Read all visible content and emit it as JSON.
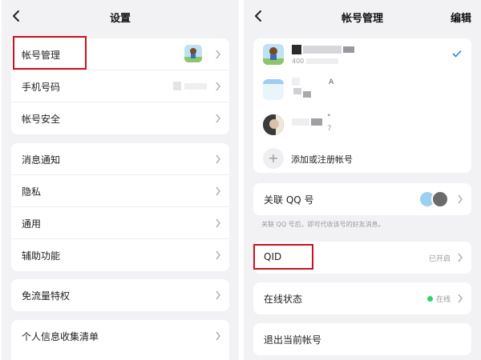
{
  "left": {
    "title": "设置",
    "group1": [
      {
        "label": "帐号管理"
      },
      {
        "label": "手机号码"
      },
      {
        "label": "帐号安全"
      }
    ],
    "group2": [
      {
        "label": "消息通知"
      },
      {
        "label": "隐私"
      },
      {
        "label": "通用"
      },
      {
        "label": "辅助功能"
      }
    ],
    "group3": [
      {
        "label": "免流量特权"
      }
    ],
    "group4": [
      {
        "label": "个人信息收集清单"
      }
    ]
  },
  "right": {
    "title": "帐号管理",
    "action": "编辑",
    "accounts": [
      {
        "id_partial": "400",
        "selected": true
      },
      {
        "id_partial": "A",
        "selected": false
      },
      {
        "id_partial": "7",
        "selected": false
      }
    ],
    "add_account": "添加或注册帐号",
    "link_qq": "关联 QQ 号",
    "link_qq_hint": "关联 QQ 号后，即可代收该号的好友消息。",
    "qid_label": "QID",
    "qid_status": "已开启",
    "online_label": "在线状态",
    "online_status": "在线",
    "logout_label": "退出当前帐号"
  },
  "colors": {
    "background": "#f2f2f5",
    "card": "#ffffff",
    "highlight_box": "#c9121e",
    "check": "#1e88e5",
    "online": "#2ed573"
  },
  "icons": {
    "back": "chevron-left-icon",
    "chevron": "chevron-right-icon",
    "check": "check-icon",
    "add": "plus-icon"
  }
}
